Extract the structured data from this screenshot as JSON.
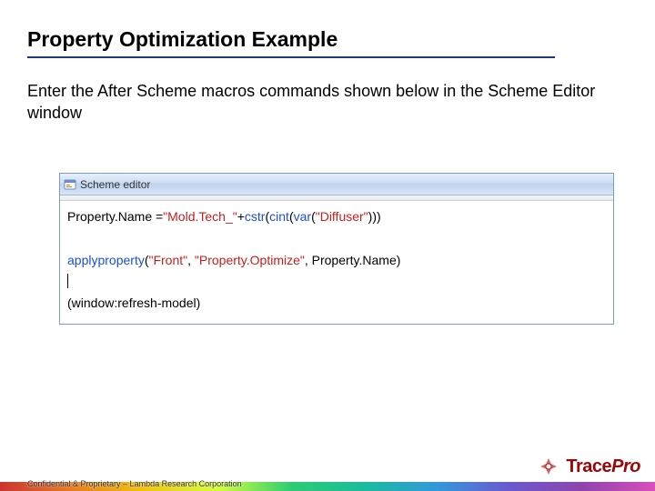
{
  "title": "Property Optimization Example",
  "instruction": "Enter the After Scheme macros commands shown below in the Scheme Editor window",
  "editor": {
    "window_title": "Scheme editor",
    "line1": {
      "a": "Property.Name =",
      "b": "\"Mold.Tech_\"",
      "c": "+",
      "d": "cstr",
      "e": "(",
      "f": "cint",
      "g": "(",
      "h": "var",
      "i": "(",
      "j": "\"Diffuser\"",
      "k": ")))"
    },
    "line2": {
      "a": "applyproperty",
      "b": "(",
      "c": "\"Front\"",
      "d": ", ",
      "e": "\"Property.Optimize\"",
      "f": ", Property.Name)"
    },
    "line3": "(window:refresh-model)"
  },
  "footer_text": "Confidential & Proprietary – Lambda Research Corporation",
  "brand": {
    "name": "Trace",
    "suffix": "Pro"
  }
}
